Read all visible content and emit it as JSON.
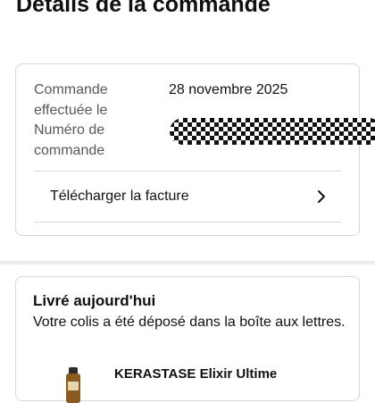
{
  "page": {
    "title": "Détails de la commande"
  },
  "order": {
    "placed_label_line1": "Commande",
    "placed_label_line2": "effectuée le",
    "number_label_line1": "Numéro de",
    "number_label_line2": "commande",
    "placed_date": "28 novembre 2025",
    "invoice_label": "Télécharger la facture",
    "invoice_icon": "chevron-right-icon"
  },
  "delivery": {
    "status_title": "Livré aujourd'hui",
    "status_text": "Votre colis a été déposé dans la boîte aux lettres.",
    "product_name": "KERASTASE Elixir Ultime"
  }
}
